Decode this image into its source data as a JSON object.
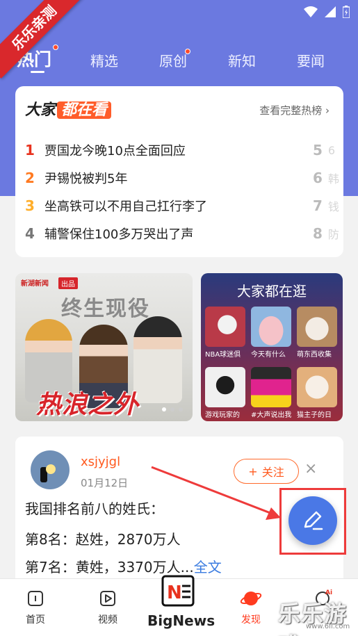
{
  "ribbon": "乐乐亲测",
  "tabs": [
    {
      "label": "热门",
      "active": true,
      "dot": true
    },
    {
      "label": "精选",
      "active": false,
      "dot": false
    },
    {
      "label": "原创",
      "active": false,
      "dot": true
    },
    {
      "label": "新知",
      "active": false,
      "dot": false
    },
    {
      "label": "要闻",
      "active": false,
      "dot": false
    }
  ],
  "hot": {
    "title_prefix": "大家",
    "title_highlight": "都在看",
    "more_label": "查看完整热榜",
    "items": [
      {
        "rank": "1",
        "text": "贾国龙今晚10点全面回应",
        "color": "#e8321e"
      },
      {
        "rank": "2",
        "text": "尹锡悦被判5年",
        "color": "#ff7a21"
      },
      {
        "rank": "3",
        "text": "坐高铁可以不用自己扛行李了",
        "color": "#ffae2b"
      },
      {
        "rank": "4",
        "text": "辅警保住100多万哭出了声",
        "color": "#777777"
      }
    ],
    "side_items": [
      {
        "rank": "5",
        "text": "6"
      },
      {
        "rank": "6",
        "text": "韩"
      },
      {
        "rank": "7",
        "text": "钱"
      },
      {
        "rank": "8",
        "text": "防"
      }
    ]
  },
  "banner": {
    "source": "新湖新闻",
    "tag": "出品",
    "title": "终生现役",
    "logo": "热浪之外"
  },
  "browse": {
    "title": "大家都在逛",
    "cells": [
      {
        "label": "NBA球迷俱",
        "color": "#c44a55"
      },
      {
        "label": "今天有什么",
        "color": "#e7b3b9"
      },
      {
        "label": "萌东西收集",
        "color": "#d9c7b3"
      },
      {
        "label": "游戏玩家的",
        "color": "#3a3a3a"
      },
      {
        "label": "#大声说出我",
        "color": "#c0208a"
      },
      {
        "label": "猫主子的日",
        "color": "#e8c9a8"
      }
    ]
  },
  "post": {
    "username": "xsjyjgl",
    "date": "01月12日",
    "follow_label": "关注",
    "follow_icon": "+",
    "close_icon": "×",
    "lines": [
      "我国排名前八的姓氏：",
      "第8名：赵姓，2870万人",
      "第7名：黄姓，3370万人..."
    ],
    "more_link": "全文"
  },
  "nav": [
    {
      "label": "首页",
      "icon": "home-icon"
    },
    {
      "label": "视频",
      "icon": "video-icon"
    },
    {
      "label": "发现",
      "icon": "planet-icon",
      "active": true
    }
  ],
  "bignews_label": "BigNews",
  "watermark": "乐乐游戏",
  "watermark_sub": "www.6ll.com",
  "colors": {
    "primary": "#6b79e0",
    "accent": "#ff5a1f",
    "fab": "#4a78e6",
    "highlight_box": "#ee3b3b"
  }
}
